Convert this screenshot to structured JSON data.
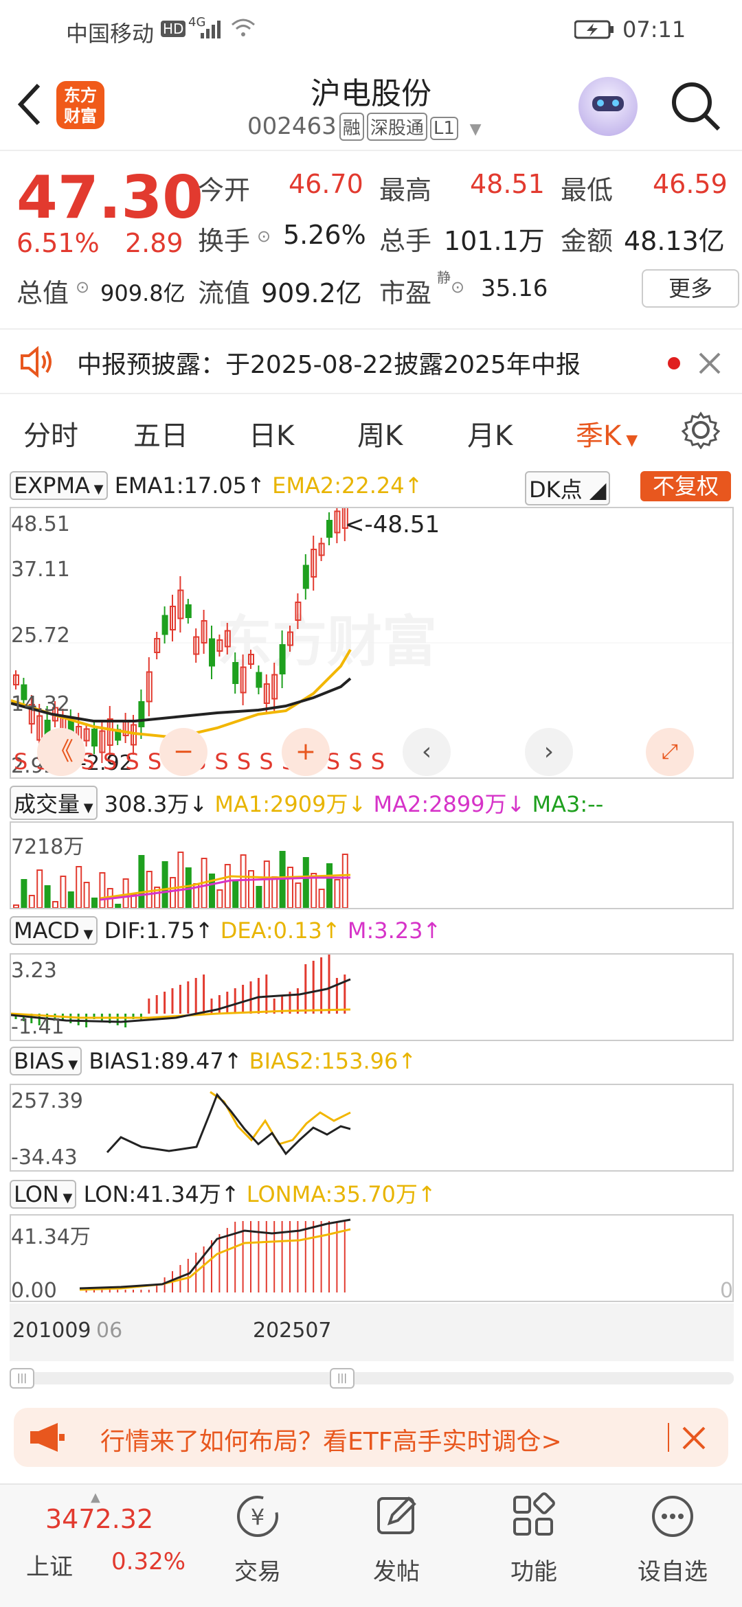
{
  "status": {
    "carrier": "中国移动",
    "hd": "HD",
    "net": "4G",
    "time": "07:11"
  },
  "header": {
    "title": "沪电股份",
    "code": "002463",
    "tags": [
      "融",
      "深股通",
      "L1"
    ],
    "logo_line1": "东方",
    "logo_line2": "财富"
  },
  "quote": {
    "price": "47.30",
    "pct": "6.51%",
    "chg": "2.89",
    "open_label": "今开",
    "open": "46.70",
    "high_label": "最高",
    "high": "48.51",
    "low_label": "最低",
    "low": "46.59",
    "turnover_label": "换手",
    "turnover": "5.26%",
    "volume_label": "总手",
    "volume": "101.1万",
    "amount_label": "金额",
    "amount": "48.13亿",
    "mktcap_label": "总值",
    "mktcap": "909.8亿",
    "float_label": "流值",
    "float": "909.2亿",
    "pe_label": "市盈",
    "pe_sup": "静",
    "pe": "35.16",
    "more": "更多"
  },
  "notice": {
    "text": "中报预披露：于2025-08-22披露2025年中报"
  },
  "tabs": [
    "分时",
    "五日",
    "日K",
    "周K",
    "月K",
    "季K"
  ],
  "main_chart": {
    "indicator": "EXPMA",
    "ema1": "EMA1:17.05↑",
    "ema2": "EMA2:22.24↑",
    "dk_btn": "DK点",
    "fq_btn": "不复权",
    "y_labels": [
      "48.51",
      "37.11",
      "25.72",
      "14.32",
      "2.92"
    ],
    "max_marker": "<-48.51",
    "min_marker": "<-2.92",
    "signals": "S S S S S S S S S S S S S S S S S",
    "watermark": "东方财富"
  },
  "volume": {
    "label": "成交量",
    "value": "308.3万↓",
    "ma1": "MA1:2909万↓",
    "ma2": "MA2:2899万↓",
    "ma3": "MA3:--",
    "y_top": "7218万"
  },
  "macd": {
    "label": "MACD",
    "dif": "DIF:1.75↑",
    "dea": "DEA:0.13↑",
    "m": "M:3.23↑",
    "y_top": "3.23",
    "y_bot": "-1.41"
  },
  "bias": {
    "label": "BIAS",
    "b1": "BIAS1:89.47↑",
    "b2": "BIAS2:153.96↑",
    "y_top": "257.39",
    "y_bot": "-34.43"
  },
  "lon": {
    "label": "LON",
    "lon": "LON:41.34万↑",
    "lonma": "LONMA:35.70万↑",
    "y_top": "41.34万",
    "y_bot": "0.00",
    "right_zero": "0"
  },
  "x_axis": {
    "left": "201009",
    "left2": "06",
    "right": "202507"
  },
  "banner": {
    "text": "行情来了如何布局？看ETF高手实时调仓>"
  },
  "bottom": {
    "index_value": "3472.32",
    "index_name": "上证",
    "index_pct": "0.32%",
    "nav": [
      "交易",
      "发帖",
      "功能",
      "设自选"
    ],
    "trade_icon_char": "¥"
  },
  "colors": {
    "up": "#e23a2f",
    "down": "#1fa01f",
    "accent": "#e8571e",
    "ema2": "#e8b400",
    "ma2": "#d633c8"
  }
}
